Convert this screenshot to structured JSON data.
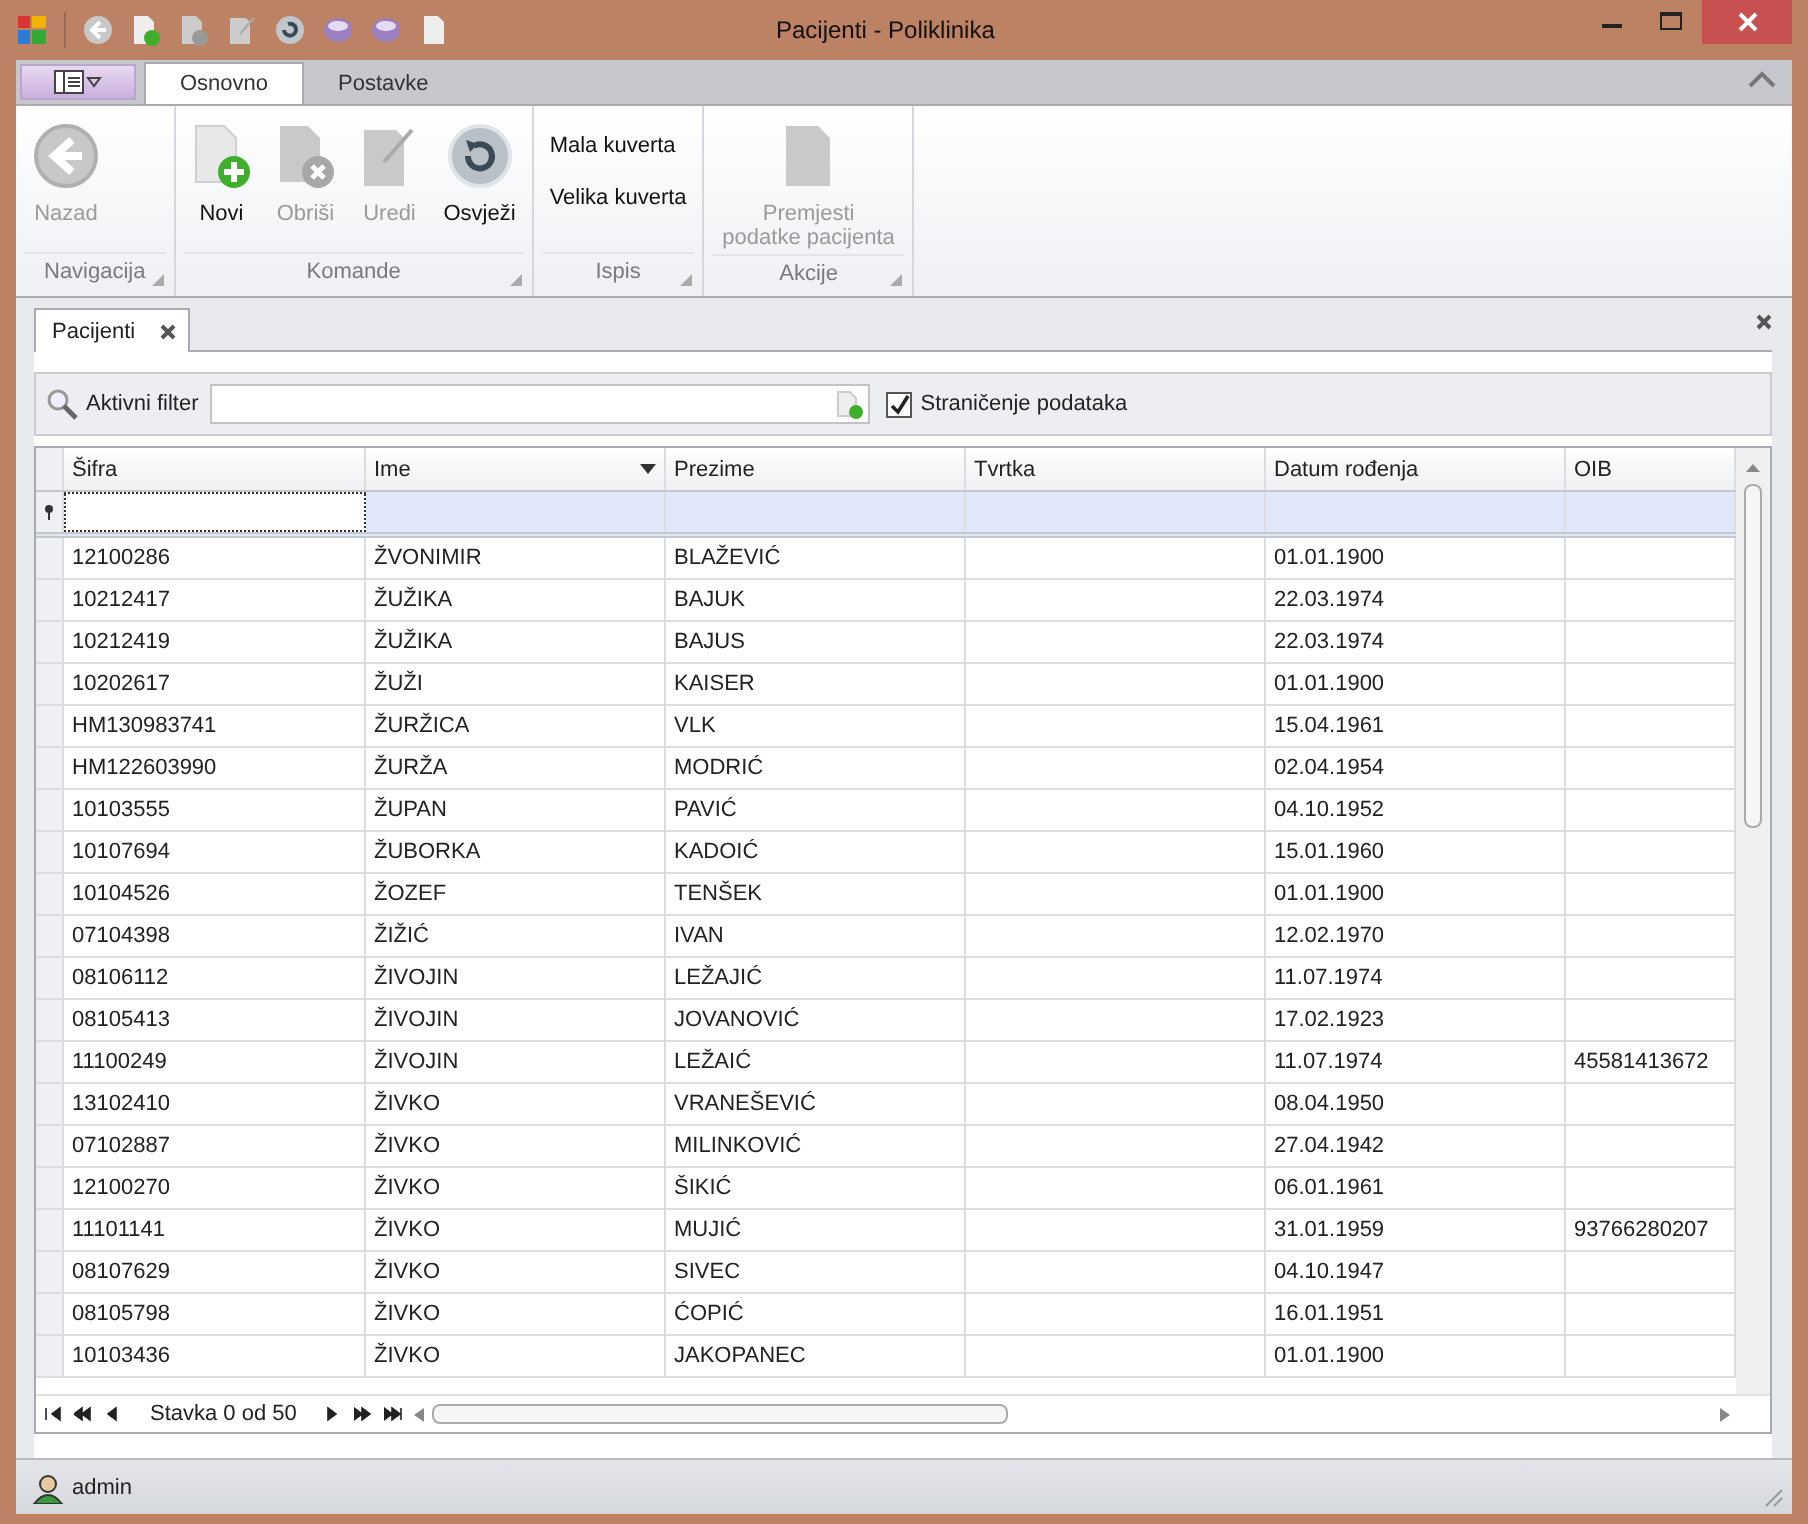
{
  "window": {
    "title": "Pacijenti - Poliklinika"
  },
  "ribbon": {
    "tabs": [
      {
        "label": "Osnovno",
        "selected": true
      },
      {
        "label": "Postavke",
        "selected": false
      }
    ],
    "groups": [
      {
        "title": "Navigacija",
        "buttons": [
          {
            "kind": "back",
            "label": "Nazad",
            "disabled": true
          }
        ]
      },
      {
        "title": "Komande",
        "buttons": [
          {
            "kind": "new",
            "label": "Novi",
            "disabled": false
          },
          {
            "kind": "delete",
            "label": "Obriši",
            "disabled": true
          },
          {
            "kind": "edit",
            "label": "Uredi",
            "disabled": true
          },
          {
            "kind": "refresh",
            "label": "Osvježi",
            "disabled": false
          }
        ]
      },
      {
        "title": "Ispis",
        "buttons": [
          {
            "kind": "small",
            "label": "Mala kuverta",
            "disabled": false
          },
          {
            "kind": "small",
            "label": "Velika kuverta",
            "disabled": false
          }
        ]
      },
      {
        "title": "Akcije",
        "buttons": [
          {
            "kind": "document",
            "label": "Premjesti podatke pacijenta",
            "disabled": true
          }
        ]
      }
    ]
  },
  "document_tab": {
    "label": "Pacijenti"
  },
  "filter": {
    "label": "Aktivni filter",
    "paging": {
      "label": "Straničenje podataka",
      "checked": true
    }
  },
  "table": {
    "columns": [
      {
        "label": "Šifra",
        "sorted": false
      },
      {
        "label": "Ime",
        "sorted": true
      },
      {
        "label": "Prezime",
        "sorted": false
      },
      {
        "label": "Tvrtka",
        "sorted": false
      },
      {
        "label": "Datum rođenja",
        "sorted": false
      },
      {
        "label": "OIB",
        "sorted": false
      }
    ],
    "rows": [
      [
        "12100286",
        "ŽVONIMIR",
        "BLAŽEVIĆ",
        "",
        "01.01.1900",
        ""
      ],
      [
        "10212417",
        "ŽUŽIKA",
        "BAJUK",
        "",
        "22.03.1974",
        ""
      ],
      [
        "10212419",
        "ŽUŽIKA",
        "BAJUS",
        "",
        "22.03.1974",
        ""
      ],
      [
        "10202617",
        "ŽUŽI",
        "KAISER",
        "",
        "01.01.1900",
        ""
      ],
      [
        "HM130983741",
        "ŽURŽICA",
        "VLK",
        "",
        "15.04.1961",
        ""
      ],
      [
        "HM122603990",
        "ŽURŽA",
        "MODRIĆ",
        "",
        "02.04.1954",
        ""
      ],
      [
        "10103555",
        "ŽUPAN",
        "PAVIĆ",
        "",
        "04.10.1952",
        ""
      ],
      [
        "10107694",
        "ŽUBORKA",
        "KADOIĆ",
        "",
        "15.01.1960",
        ""
      ],
      [
        "10104526",
        "ŽOZEF",
        "TENŠEK",
        "",
        "01.01.1900",
        ""
      ],
      [
        "07104398",
        "ŽIŽIĆ",
        "IVAN",
        "",
        "12.02.1970",
        ""
      ],
      [
        "08106112",
        "ŽIVOJIN",
        "LEŽAJIĆ",
        "",
        "11.07.1974",
        ""
      ],
      [
        "08105413",
        "ŽIVOJIN",
        "JOVANOVIĆ",
        "",
        "17.02.1923",
        ""
      ],
      [
        "11100249",
        "ŽIVOJIN",
        "LEŽAIĆ",
        "",
        "11.07.1974",
        "45581413672"
      ],
      [
        "13102410",
        "ŽIVKO",
        "VRANEŠEVIĆ",
        "",
        "08.04.1950",
        ""
      ],
      [
        "07102887",
        "ŽIVKO",
        "MILINKOVIĆ",
        "",
        "27.04.1942",
        ""
      ],
      [
        "12100270",
        "ŽIVKO",
        "ŠIKIĆ",
        "",
        "06.01.1961",
        ""
      ],
      [
        "11101141",
        "ŽIVKO",
        "MUJIĆ",
        "",
        "31.01.1959",
        "93766280207"
      ],
      [
        "08107629",
        "ŽIVKO",
        "SIVEC",
        "",
        "04.10.1947",
        ""
      ],
      [
        "08105798",
        "ŽIVKO",
        "ĆOPIĆ",
        "",
        "16.01.1951",
        ""
      ],
      [
        "10103436",
        "ŽIVKO",
        "JAKOPANEC",
        "",
        "01.01.1900",
        ""
      ]
    ]
  },
  "pager": {
    "label": "Stavka 0 od 50"
  },
  "status_bar": {
    "user": "admin"
  }
}
